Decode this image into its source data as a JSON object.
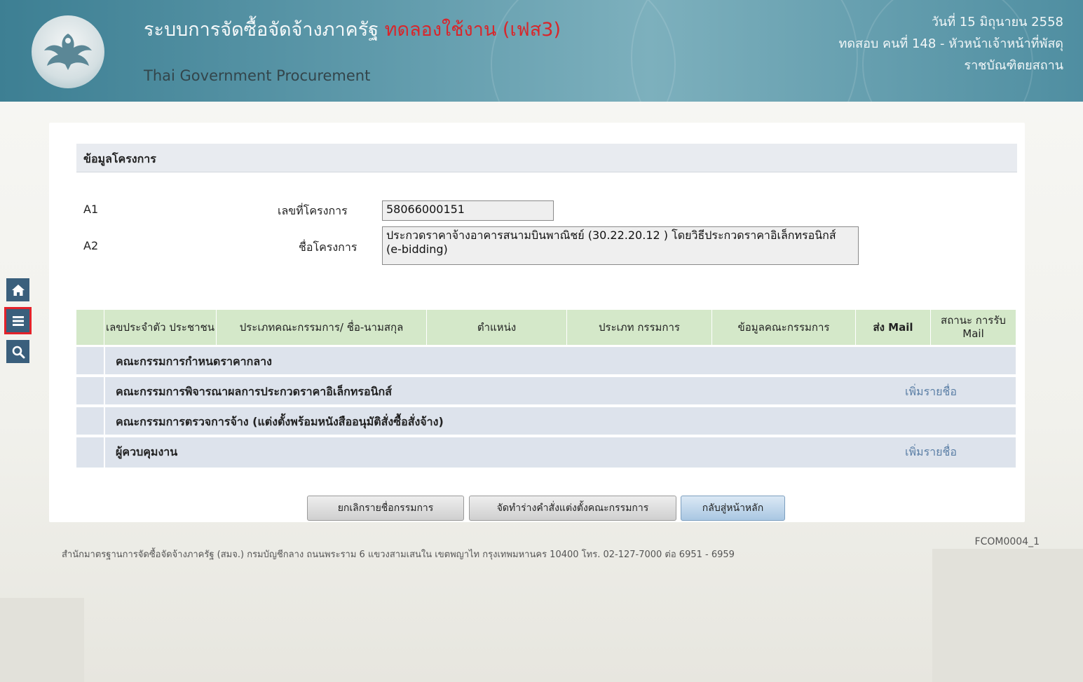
{
  "header": {
    "system_title": "ระบบการจัดซื้อจัดจ้างภาครัฐ",
    "trial_label": "ทดลองใช้งาน (เฟส3)",
    "subtitle": "Thai Government Procurement",
    "date": "วันที่ 15 มิถุนายน 2558",
    "user": "ทดสอบ คนที่ 148 - หัวหน้าเจ้าหน้าที่พัสดุ",
    "organization": "ราชบัณฑิตยสถาน",
    "logo_icon": "garuda-emblem-icon"
  },
  "sidebar": {
    "items": [
      {
        "icon": "home-icon"
      },
      {
        "icon": "menu-icon"
      },
      {
        "icon": "search-icon"
      }
    ]
  },
  "section": {
    "title": "ข้อมูลโครงการ"
  },
  "project": {
    "a1_code": "A1",
    "a1_label": "เลขที่โครงการ",
    "a1_value": "58066000151",
    "a2_code": "A2",
    "a2_label": "ชื่อโครงการ",
    "a2_value": "ประกวดราคาจ้างอาคารสนามบินพาณิชย์ (30.22.20.12 ) โดยวิธีประกวดราคาอิเล็กทรอนิกส์ (e-bidding)"
  },
  "table": {
    "columns": [
      "เลขประจำตัว ประชาชน",
      "ประเภทคณะกรรมการ/ ชื่อ-นามสกุล",
      "ตำแหน่ง",
      "ประเภท กรรมการ",
      "ข้อมูลคณะกรรมการ",
      "ส่ง Mail",
      "สถานะ การรับ Mail"
    ],
    "rows": [
      {
        "label": "คณะกรรมการกำหนดราคากลาง",
        "action": ""
      },
      {
        "label": "คณะกรรมการพิจารณาผลการประกวดราคาอิเล็กทรอนิกส์",
        "action": "เพิ่มรายชื่อ"
      },
      {
        "label": "คณะกรรมการตรวจการจ้าง (แต่งตั้งพร้อมหนังสืออนุมัติสั่งซื้อสั่งจ้าง)",
        "action": ""
      },
      {
        "label": "ผู้ควบคุมงาน",
        "action": "เพิ่มรายชื่อ"
      }
    ]
  },
  "buttons": {
    "cancel": "ยกเลิกรายชื่อกรรมการ",
    "draft": "จัดทำร่างคำสั่งแต่งตั้งคณะกรรมการ",
    "back": "กลับสู่หน้าหลัก"
  },
  "footer": {
    "address": "สำนักมาตรฐานการจัดซื้อจัดจ้างภาครัฐ (สมจ.) กรมบัญชีกลาง ถนนพระราม 6 แขวงสามเสนใน เขตพญาไท กรุงเทพมหานคร 10400 โทร. 02-127-7000 ต่อ 6951 - 6959",
    "page_code": "FCOM0004_1"
  },
  "annotation": {
    "arrow_color": "#e3222a"
  },
  "colors": {
    "header": "#4f8ea1",
    "trial": "#d8262b",
    "table_header": "#d4e8c9",
    "table_row": "#dde3ec",
    "link": "#5b7fa6",
    "sidebar": "#3a5f7c"
  }
}
